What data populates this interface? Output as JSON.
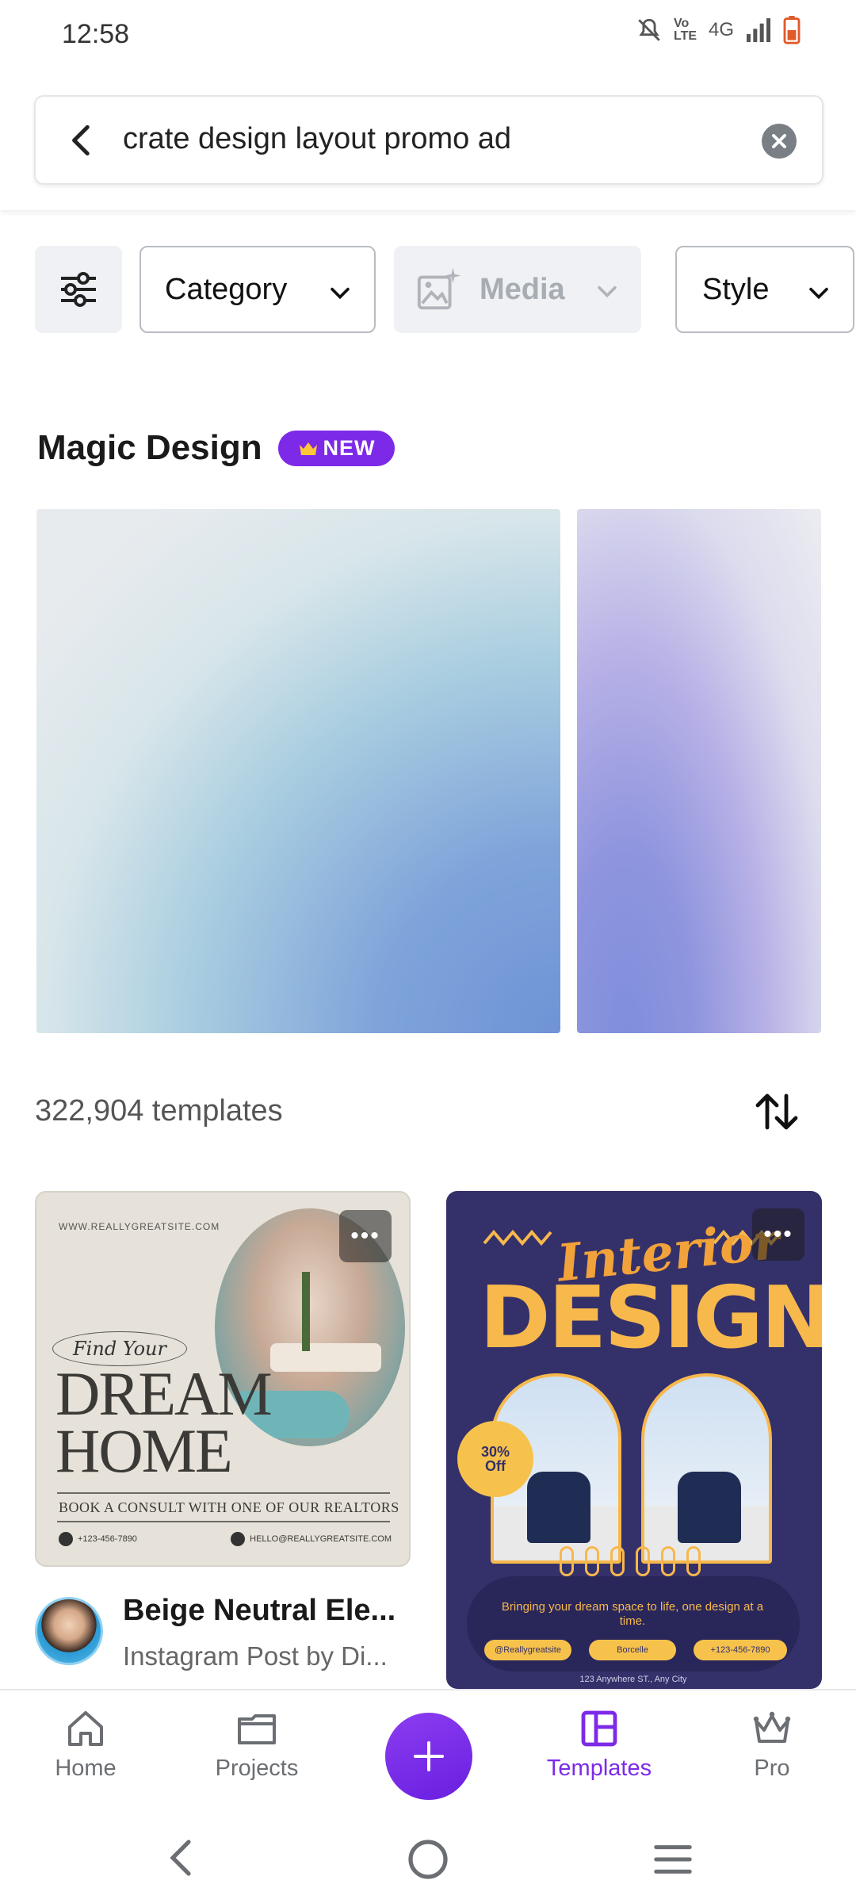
{
  "status_bar": {
    "time": "12:58",
    "network": "4G",
    "volte": "Vo LTE",
    "icons": [
      "mute-bell-icon",
      "volte-icon",
      "network-4g-icon",
      "signal-icon",
      "battery-low-icon"
    ]
  },
  "search": {
    "query": "crate design layout promo ad",
    "back_icon": "chevron-left-icon",
    "clear_icon": "clear-circle-icon"
  },
  "filters": {
    "settings_icon": "sliders-icon",
    "category_label": "Category",
    "media_label": "Media",
    "style_label": "Style"
  },
  "magic_design": {
    "title": "Magic Design",
    "badge": "NEW"
  },
  "results": {
    "count_label": "322,904 templates",
    "sort_icon": "sort-arrows-icon"
  },
  "templates": [
    {
      "site": "WWW.REALLYGREATSITE.COM",
      "find_your": "Find Your",
      "headline_1": "DREAM",
      "headline_2": "HOME",
      "consult": "BOOK A CONSULT WITH ONE OF OUR REALTORS",
      "phone": "+123-456-7890",
      "email": "HELLO@REALLYGREATSITE.COM",
      "title": "Beige Neutral Ele...",
      "subtitle": "Instagram Post by Di..."
    },
    {
      "script": "Interior",
      "headline": "DESIGN",
      "badge_line1": "30%",
      "badge_line2": "Off",
      "tagline": "Bringing your dream space to life, one design at a time.",
      "handle": "@Reallygreatsite",
      "brand": "Borcelle",
      "phone": "+123-456-7890",
      "address": "123 Anywhere ST., Any City"
    }
  ],
  "bottom_nav": {
    "items": [
      {
        "label": "Home",
        "icon": "home-icon"
      },
      {
        "label": "Projects",
        "icon": "folder-icon"
      },
      {
        "label": "",
        "icon": "plus-icon"
      },
      {
        "label": "Templates",
        "icon": "templates-icon"
      },
      {
        "label": "Pro",
        "icon": "crown-icon"
      }
    ],
    "active": "Templates"
  },
  "colors": {
    "accent": "#7d2ae8",
    "text_muted": "#6b6e73"
  }
}
